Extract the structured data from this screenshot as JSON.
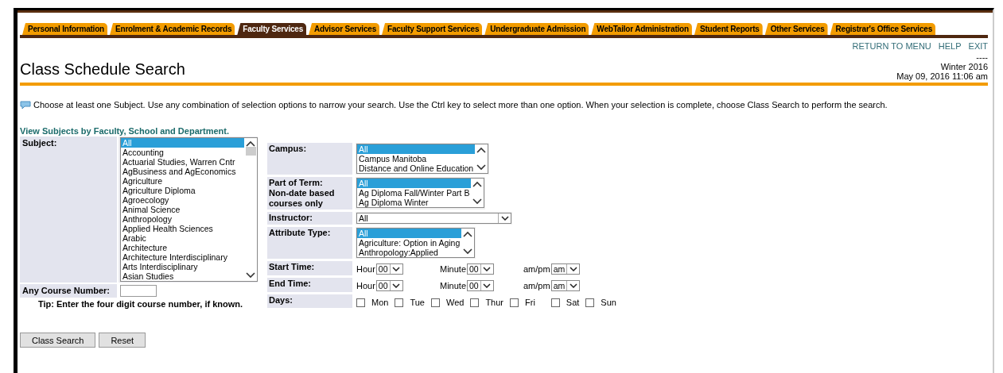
{
  "tabs": [
    {
      "label": "Personal Information",
      "selected": false
    },
    {
      "label": "Enrolment & Academic Records",
      "selected": false
    },
    {
      "label": "Faculty Services",
      "selected": true
    },
    {
      "label": "Advisor Services",
      "selected": false
    },
    {
      "label": "Faculty Support Services",
      "selected": false
    },
    {
      "label": "Undergraduate Admission",
      "selected": false
    },
    {
      "label": "WebTailor Administration",
      "selected": false
    },
    {
      "label": "Student Reports",
      "selected": false
    },
    {
      "label": "Other Services",
      "selected": false
    },
    {
      "label": "Registrar's Office Services",
      "selected": false
    }
  ],
  "header_links": [
    "RETURN TO MENU",
    "HELP",
    "EXIT"
  ],
  "page_title": "Class Schedule Search",
  "info": {
    "separator": "----",
    "term": "Winter 2016",
    "datetime": "May 09, 2016 11:06 am"
  },
  "instructions": "Choose at least one Subject. Use any combination of selection options to narrow your search. Use the Ctrl key to select more than one option. When your selection is complete, choose Class Search to perform the search.",
  "subjects_link": "View Subjects by Faculty, School and Department.",
  "subject": {
    "label": "Subject:",
    "options": [
      {
        "label": "All",
        "selected": true
      },
      {
        "label": "Accounting",
        "selected": false
      },
      {
        "label": "Actuarial Studies, Warren Cntr",
        "selected": false
      },
      {
        "label": "AgBusiness and AgEconomics",
        "selected": false
      },
      {
        "label": "Agriculture",
        "selected": false
      },
      {
        "label": "Agriculture Diploma",
        "selected": false
      },
      {
        "label": "Agroecology",
        "selected": false
      },
      {
        "label": "Animal Science",
        "selected": false
      },
      {
        "label": "Anthropology",
        "selected": false
      },
      {
        "label": "Applied Health Sciences",
        "selected": false
      },
      {
        "label": "Arabic",
        "selected": false
      },
      {
        "label": "Architecture",
        "selected": false
      },
      {
        "label": "Architecture Interdisciplinary",
        "selected": false
      },
      {
        "label": "Arts Interdisciplinary",
        "selected": false
      },
      {
        "label": "Asian Studies",
        "selected": false
      }
    ]
  },
  "course_number": {
    "label": "Any Course Number:"
  },
  "tip": "Tip: Enter the four digit course number, if known.",
  "filters": [
    {
      "kind": "listbox",
      "label": "Campus:",
      "options": [
        {
          "label": "All",
          "selected": true
        },
        {
          "label": "Campus Manitoba",
          "selected": false
        },
        {
          "label": "Distance and Online Education",
          "selected": false
        }
      ]
    },
    {
      "kind": "listbox",
      "label": "Part of Term:\nNon-date based\ncourses only",
      "options": [
        {
          "label": "All",
          "selected": true
        },
        {
          "label": "Ag Diploma Fall/Winter Part B",
          "selected": false
        },
        {
          "label": "Ag Diploma Winter",
          "selected": false
        }
      ]
    },
    {
      "kind": "dropdown",
      "label": "Instructor:",
      "value": "All"
    },
    {
      "kind": "listbox",
      "label": "Attribute Type:",
      "options": [
        {
          "label": "All",
          "selected": true
        },
        {
          "label": "Agriculture: Option in Aging",
          "selected": false
        },
        {
          "label": "Anthropology:Applied",
          "selected": false
        }
      ]
    },
    {
      "kind": "time",
      "label": "Start Time:",
      "fields": [
        {
          "label": "Hour",
          "value": "00"
        },
        {
          "label": "Minute",
          "value": "00"
        },
        {
          "label": "am/pm",
          "value": "am"
        }
      ]
    },
    {
      "kind": "time",
      "label": "End Time:",
      "fields": [
        {
          "label": "Hour",
          "value": "00"
        },
        {
          "label": "Minute",
          "value": "00"
        },
        {
          "label": "am/pm",
          "value": "am"
        }
      ]
    },
    {
      "kind": "days",
      "label": "Days:",
      "days": [
        {
          "label": "Mon",
          "checked": false
        },
        {
          "label": "Tue",
          "checked": false
        },
        {
          "label": "Wed",
          "checked": false
        },
        {
          "label": "Thur",
          "checked": false
        },
        {
          "label": "Fri",
          "checked": false
        },
        {
          "label": "Sat",
          "checked": false
        },
        {
          "label": "Sun",
          "checked": false
        }
      ]
    }
  ],
  "buttons": [
    "Class Search",
    "Reset"
  ]
}
